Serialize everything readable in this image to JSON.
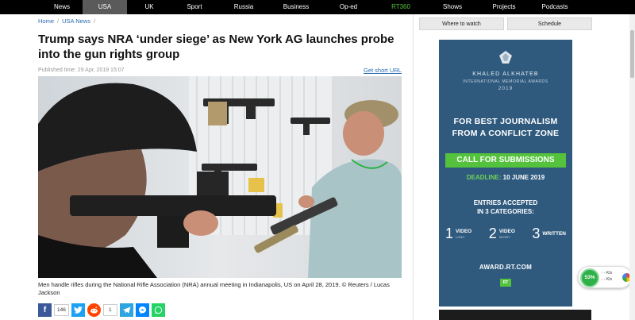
{
  "nav": {
    "items": [
      "News",
      "USA",
      "UK",
      "Sport",
      "Russia",
      "Business",
      "Op-ed",
      "RT360",
      "Shows",
      "Projects",
      "Podcasts"
    ],
    "active": "USA"
  },
  "breadcrumb": [
    "Home",
    "USA News"
  ],
  "article": {
    "title": "Trump says NRA ‘under siege’ as New York AG launches probe into the gun rights group",
    "published": "Published time: 29 Apr, 2019 15:07",
    "short_url": "Get short URL",
    "caption": "Men handle rifles during the National Rifle Association (NRA) annual meeting in Indianapolis, US on April 28, 2019. © Reuters / Lucas Jackson"
  },
  "share": {
    "facebook_count": "146",
    "reddit_count": "1"
  },
  "sidebar": {
    "where_to_watch": "Where to watch",
    "schedule": "Schedule"
  },
  "ad": {
    "name": "KHALED ALKHATEB",
    "subtitle": "INTERNATIONAL MEMORIAL AWARDS",
    "year": "2019",
    "headline_1": "FOR BEST JOURNALISM",
    "headline_2": "FROM A CONFLICT ZONE",
    "cta": "CALL FOR SUBMISSIONS",
    "deadline_label": "DEADLINE:",
    "deadline_date": "10 JUNE 2019",
    "entries_1": "ENTRIES ACCEPTED",
    "entries_2": "IN 3 CATEGORIES:",
    "cat1_num": "1",
    "cat1_label": "VIDEO",
    "cat1_sub": "LONG",
    "cat2_num": "2",
    "cat2_label": "VIDEO",
    "cat2_sub": "SHORT",
    "cat3_num": "3",
    "cat3_label": "WRITTEN",
    "website": "AWARD.RT.COM",
    "rt_logo": "RT"
  },
  "speed_widget": {
    "percent": "53%",
    "up": "- K/s",
    "down": "- K/s"
  },
  "colors": {
    "accent_green": "#54c23c",
    "ad_blue": "#2f5a7e",
    "link_blue": "#2a6bb1"
  }
}
